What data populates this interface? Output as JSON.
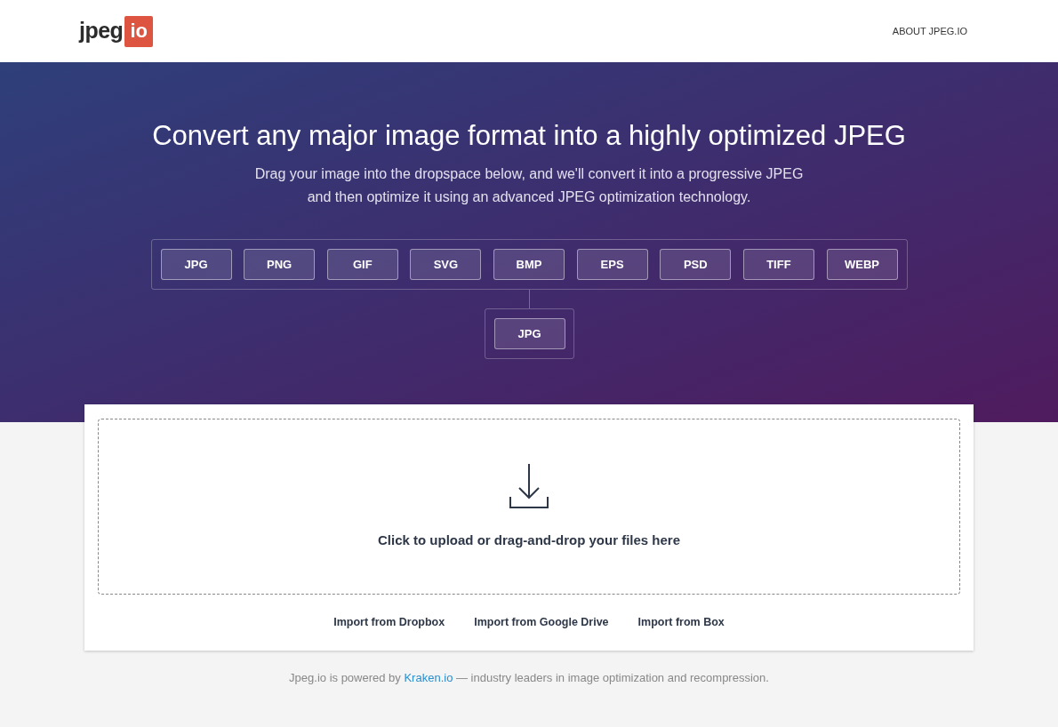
{
  "header": {
    "logo": {
      "text": "jpeg",
      "badge": "io"
    },
    "nav_link": "ABOUT JPEG.IO"
  },
  "hero": {
    "title": "Convert any major image format into a highly optimized JPEG",
    "subtitle_lines": [
      "Drag your image into the dropspace below, and we'll convert it into a progressive JPEG",
      "and then optimize it using an advanced JPEG optimization technology."
    ],
    "input_formats": [
      "JPG",
      "PNG",
      "GIF",
      "SVG",
      "BMP",
      "EPS",
      "PSD",
      "TIFF",
      "WEBP"
    ],
    "output_format": "JPG"
  },
  "dropzone": {
    "text": "Click to upload or drag-and-drop your files here"
  },
  "import_links": [
    "Import from Dropbox",
    "Import from Google Drive",
    "Import from Box"
  ],
  "footer": {
    "before": "Jpeg.io is powered by ",
    "link": "Kraken.io",
    "after": " — industry leaders in image optimization and recompression."
  }
}
